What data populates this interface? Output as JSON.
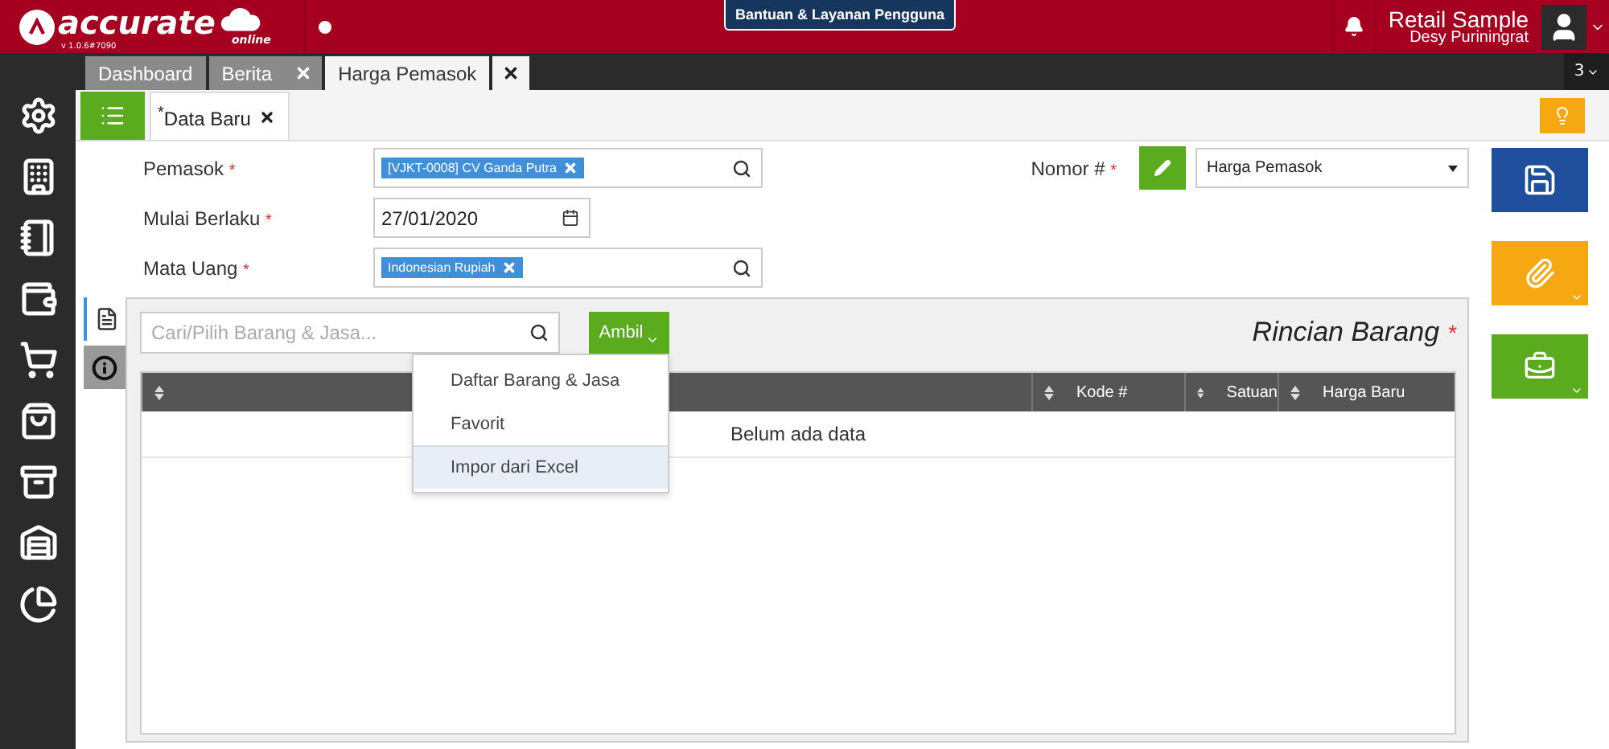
{
  "header": {
    "brand": "accurate",
    "brand_sub": "online",
    "version": "v 1.0.6#7090",
    "help_button": "Bantuan & Layanan Pengguna",
    "company": "Retail Sample",
    "user": "Desy Puriningrat"
  },
  "tabs": [
    {
      "label": "Dashboard",
      "closable": false,
      "selected": false
    },
    {
      "label": "Berita",
      "closable": true,
      "selected": false
    },
    {
      "label": "Harga Pemasok",
      "closable": true,
      "selected": true
    }
  ],
  "tab_count": "3",
  "doc_tabs": [
    {
      "label": "Data Baru",
      "mark": "*",
      "selected": true
    }
  ],
  "form": {
    "fields": [
      {
        "kind": "lookup",
        "label": "Pemasok",
        "required_mark": "*",
        "tag": "[VJKT-0008] CV Ganda Putra"
      },
      {
        "kind": "date",
        "label": "Mulai Berlaku",
        "required_mark": "*",
        "value": "27/01/2020"
      },
      {
        "kind": "lookup",
        "label": "Mata Uang",
        "required_mark": "*",
        "tag": "Indonesian Rupiah"
      }
    ],
    "number": {
      "label": "Nomor #",
      "required_mark": "*",
      "value": "Harga Pemasok"
    }
  },
  "details": {
    "side_tabs": [
      {
        "kind": "list",
        "selected": true
      },
      {
        "kind": "info",
        "selected": false
      }
    ],
    "search": {
      "placeholder": "Cari/Pilih Barang & Jasa..."
    },
    "take_button": "Ambil",
    "title": "Rincian Barang",
    "required_mark": "*",
    "table": {
      "columns": [
        {
          "sortable": true
        },
        {
          "label": "Kode #",
          "sortable": true
        },
        {
          "label": "Satuan",
          "sortable": true
        },
        {
          "label": "Harga Baru",
          "sortable": true
        }
      ],
      "empty_text": "Belum ada data"
    },
    "menu": [
      {
        "label": "Daftar Barang & Jasa",
        "selected": false
      },
      {
        "label": "Favorit",
        "selected": false
      },
      {
        "label": "Impor dari Excel",
        "selected": true
      }
    ]
  }
}
